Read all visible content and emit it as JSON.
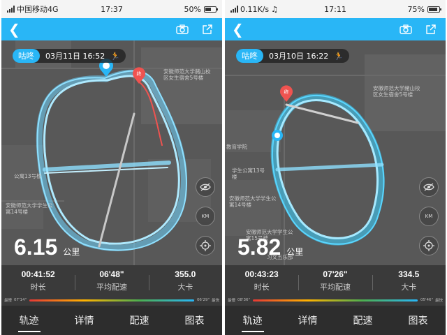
{
  "screens": [
    {
      "status": {
        "carrier": "中国移动4G",
        "time": "17:37",
        "battery": "50%",
        "battery_level": 0.5
      },
      "date_pill": {
        "brand": "咕咚",
        "date": "03月11日 16:52"
      },
      "map_labels": [
        "安徽师范大学赭山校区女生宿舍5号楼",
        "公寓13号楼",
        "安徽师范大学学生公寓14号楼"
      ],
      "start_marker_icon": "fan-icon",
      "end_marker_label": "终",
      "distance": {
        "value": "6.15",
        "unit": "公里"
      },
      "stats": [
        {
          "value": "00:41:52",
          "label": "时长"
        },
        {
          "value": "06'48\"",
          "label": "平均配速"
        },
        {
          "value": "355.0",
          "label": "大卡"
        }
      ],
      "pace_legend": {
        "slow_label": "最慢",
        "slow_value": "07'14\"",
        "fast_value": "06'29\"",
        "fast_label": "最快"
      },
      "fab_km_label": "KM"
    },
    {
      "status": {
        "carrier": "0.11K/s",
        "time": "17:11",
        "battery": "75%",
        "battery_level": 0.75
      },
      "date_pill": {
        "brand": "咕咚",
        "date": "03月10日 16:22"
      },
      "map_labels": [
        "安徽师范大学赭山校区女生宿舍5号楼",
        "教育学院",
        "学生公寓13号楼",
        "安徽师范大学学生公寓14号楼",
        "安徽师范大学学生公寓15号楼",
        "习文五乐部"
      ],
      "start_marker_icon": "fan-icon",
      "end_marker_label": "终",
      "distance": {
        "value": "5.82",
        "unit": "公里"
      },
      "stats": [
        {
          "value": "00:43:23",
          "label": "时长"
        },
        {
          "value": "07'26\"",
          "label": "平均配速"
        },
        {
          "value": "334.5",
          "label": "大卡"
        }
      ],
      "pace_legend": {
        "slow_label": "最慢",
        "slow_value": "08'36\"",
        "fast_value": "05'46\"",
        "fast_label": "最快"
      },
      "fab_km_label": "KM"
    }
  ],
  "tabs": [
    "轨迹",
    "详情",
    "配速",
    "图表"
  ],
  "colors": {
    "accent": "#29b6f6",
    "track": "#7fdcff",
    "end_marker": "#ef5350"
  }
}
